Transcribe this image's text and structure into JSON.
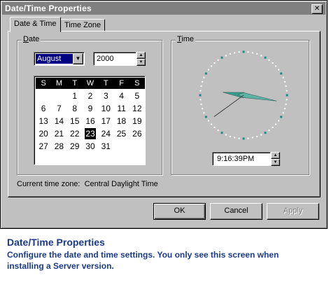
{
  "window": {
    "title": "Date/Time Properties",
    "close_glyph": "✕"
  },
  "tabs": [
    {
      "label": "Date & Time",
      "active": true
    },
    {
      "label": "Time Zone",
      "active": false
    }
  ],
  "date_group": {
    "label_first": "D",
    "label_rest": "ate",
    "month": "August",
    "year": "2000",
    "weekdays": [
      "S",
      "M",
      "T",
      "W",
      "T",
      "F",
      "S"
    ],
    "weeks": [
      [
        "",
        "",
        "1",
        "2",
        "3",
        "4",
        "5"
      ],
      [
        "6",
        "7",
        "8",
        "9",
        "10",
        "11",
        "12"
      ],
      [
        "13",
        "14",
        "15",
        "16",
        "17",
        "18",
        "19"
      ],
      [
        "20",
        "21",
        "22",
        "23",
        "24",
        "25",
        "26"
      ],
      [
        "27",
        "28",
        "29",
        "30",
        "31",
        "",
        ""
      ]
    ],
    "selected_day": "23"
  },
  "time_group": {
    "label_first": "T",
    "label_rest": "ime",
    "time_value": "9:16:39PM",
    "clock": {
      "hour": 9,
      "minute": 16,
      "second": 39
    }
  },
  "timezone": {
    "prefix": "Current time zone:",
    "name": "Central Daylight Time"
  },
  "buttons": {
    "ok": "OK",
    "cancel": "Cancel",
    "apply": "Apply"
  },
  "caption": {
    "title": "Date/Time Properties",
    "text": "Configure the date and time settings. You only see this screen when installing a Server version."
  },
  "colors": {
    "title_bar": "#808080",
    "face": "#c0c0c0",
    "selection": "#000080",
    "clock_hand": "#3a9a8a",
    "caption": "#1a3a8a"
  }
}
